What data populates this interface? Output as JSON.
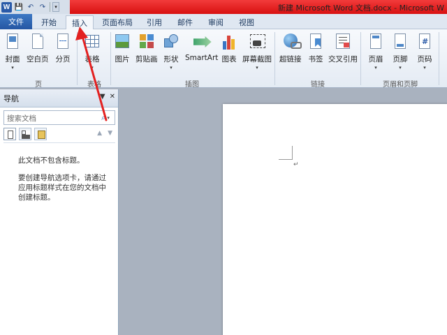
{
  "titlebar": {
    "title": "新建 Microsoft Word 文档.docx - Microsoft W",
    "app_logo": "W"
  },
  "qat": {
    "save_icon": "save-icon",
    "undo_icon": "undo-icon",
    "redo_icon": "redo-icon"
  },
  "tabs": [
    {
      "label": "文件"
    },
    {
      "label": "开始"
    },
    {
      "label": "插入"
    },
    {
      "label": "页面布局"
    },
    {
      "label": "引用"
    },
    {
      "label": "邮件"
    },
    {
      "label": "审阅"
    },
    {
      "label": "视图"
    }
  ],
  "ribbon": {
    "cover": "封面",
    "blank_page": "空白页",
    "page_break": "分页",
    "table": "表格",
    "picture": "图片",
    "clipart": "剪贴画",
    "shapes": "形状",
    "smartart": "SmartArt",
    "chart": "图表",
    "screenshot": "屏幕截图",
    "hyperlink": "超链接",
    "bookmark": "书签",
    "crossref": "交叉引用",
    "header": "页眉",
    "footer": "页脚",
    "page_number": "页码",
    "groups": {
      "pages": "页",
      "tables": "表格",
      "illustrations": "插图",
      "links": "链接",
      "header_footer": "页眉和页脚"
    }
  },
  "navpane": {
    "title": "导航",
    "search_placeholder": "搜索文档",
    "message1": "此文档不包含标题。",
    "message2": "要创建导航选项卡，请通过应用标题样式在您的文档中创建标题。"
  },
  "colors": {
    "accent_red": "#e32020",
    "file_tab": "#2a62b0"
  }
}
